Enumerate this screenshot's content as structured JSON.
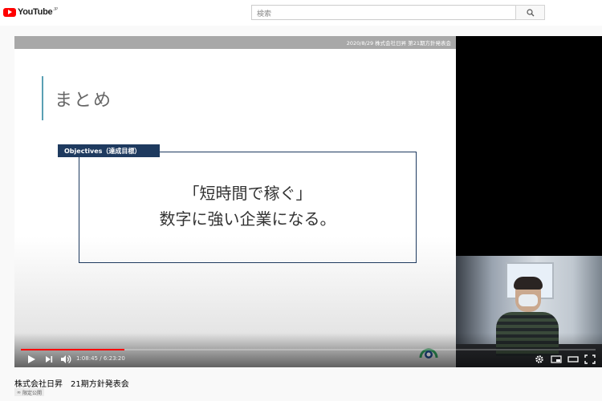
{
  "header": {
    "logo_text": "YouTube",
    "logo_region": "JP",
    "search_placeholder": "検索"
  },
  "slide": {
    "header_text": "2020/8/29 株式会社日昇 第21期方針発表会",
    "title": "まとめ",
    "objectives_tag": "Objectives（達成目標）",
    "line1": "「短時間で稼ぐ」",
    "line2": "数字に強い企業になる。"
  },
  "player": {
    "progress_fraction": 0.18,
    "time_current": "1:08:45",
    "time_separator": " / ",
    "time_total": "6:23:20",
    "accent_color": "#ff0000"
  },
  "video": {
    "title": "株式会社日昇　21期方針発表会",
    "visibility_badge": "限定公開"
  }
}
